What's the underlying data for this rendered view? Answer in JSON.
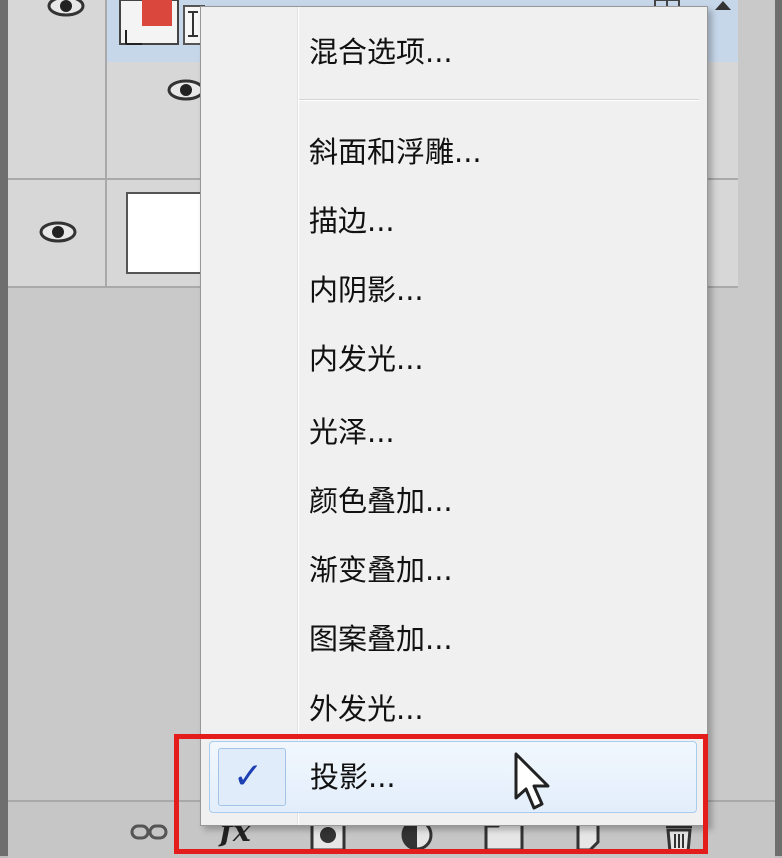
{
  "context_menu": {
    "blending_options": "混合选项...",
    "items": [
      "斜面和浮雕...",
      "描边...",
      "内阴影...",
      "内发光...",
      "光泽...",
      "颜色叠加...",
      "渐变叠加...",
      "图案叠加...",
      "外发光..."
    ],
    "checked_item": {
      "label": "投影...",
      "check": "✓",
      "checked": true
    }
  },
  "bottom_bar": {
    "fx_label": "fx",
    "icons": [
      "link-layers-icon",
      "fx-icon",
      "layer-mask-icon",
      "adjustment-layer-icon",
      "new-group-icon",
      "new-layer-icon",
      "delete-icon"
    ]
  },
  "colors": {
    "panel_bg": "#c9c9c9",
    "menu_bg": "#f0f0f0",
    "highlight_border": "#e41c1c",
    "check_color": "#1c3fb4",
    "selected_row": "#c7d7ea"
  }
}
